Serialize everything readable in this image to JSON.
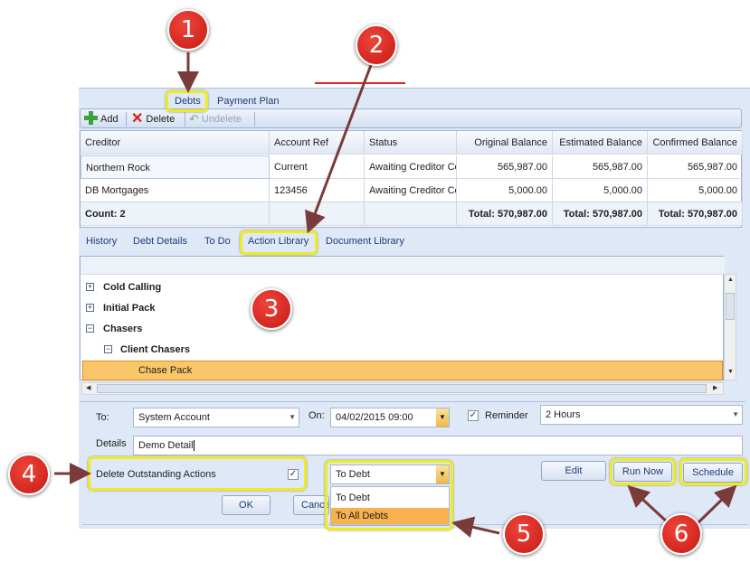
{
  "tabs": [
    "Debts",
    "Payment Plan"
  ],
  "toolbar": {
    "add": "Add",
    "delete": "Delete",
    "undelete": "Undelete"
  },
  "grid": {
    "columns": [
      "Creditor",
      "Account Ref",
      "Status",
      "Original Balance",
      "Estimated Balance",
      "Confirmed Balance"
    ],
    "rows": [
      [
        "Northern Rock",
        "Current",
        "Awaiting Creditor Co",
        "565,987.00",
        "565,987.00",
        "565,987.00"
      ],
      [
        "DB Mortgages",
        "123456",
        "Awaiting Creditor Co",
        "5,000.00",
        "5,000.00",
        "5,000.00"
      ]
    ],
    "footer": [
      "Count: 2",
      "",
      "",
      "Total: 570,987.00",
      "Total: 570,987.00",
      "Total: 570,987.00"
    ]
  },
  "subtabs": [
    "History",
    "Debt Details",
    "To Do",
    "Action Library",
    "Document Library"
  ],
  "tree": {
    "items": [
      {
        "label": "Cold Calling",
        "expander": "+"
      },
      {
        "label": "Initial Pack",
        "expander": "+"
      },
      {
        "label": "Chasers",
        "expander": "−"
      },
      {
        "label": "Client Chasers",
        "expander": "−"
      },
      {
        "label": "Chase Pack",
        "expander": ""
      }
    ]
  },
  "form": {
    "to_label": "To:",
    "to_value": "System Account",
    "on_label": "On:",
    "on_value": "04/02/2015 09:00",
    "reminder_label": "Reminder",
    "reminder_checked": "✓",
    "reminder_value": "2 Hours",
    "details_label": "Details",
    "details_value": "Demo Detail",
    "delete_outstanding_label": "Delete Outstanding Actions",
    "delete_outstanding_checked": "✓",
    "apply_value": "To Debt",
    "apply_options": [
      "To Debt",
      "To All Debts"
    ],
    "edit": "Edit",
    "run_now": "Run Now",
    "schedule": "Schedule",
    "ok": "OK",
    "cancel": "Cancel"
  },
  "callouts": [
    "1",
    "2",
    "3",
    "4",
    "5",
    "6"
  ],
  "colors": {
    "highlight": "#ecec20",
    "callout": "#d9261c",
    "selected_row": "#f9c76a",
    "arrow": "#7a3b3b"
  }
}
